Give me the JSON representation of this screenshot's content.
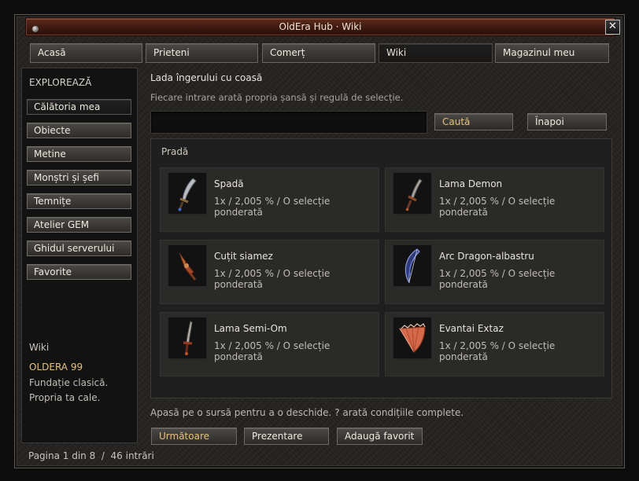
{
  "window": {
    "title": "OldEra Hub · Wiki",
    "close_label": "✕"
  },
  "tabs": [
    {
      "label": "Acasă"
    },
    {
      "label": "Prieteni"
    },
    {
      "label": "Comerț"
    },
    {
      "label": "Wiki",
      "active": true
    },
    {
      "label": "Magazinul meu"
    }
  ],
  "sidebar": {
    "heading": "EXPLOREAZĂ",
    "items": [
      {
        "label": "Călătoria mea",
        "active": true
      },
      {
        "label": "Obiecte"
      },
      {
        "label": "Metine"
      },
      {
        "label": "Monștri și șefi"
      },
      {
        "label": "Temnițe"
      },
      {
        "label": "Atelier GEM"
      },
      {
        "label": "Ghidul serverului"
      },
      {
        "label": "Favorite"
      }
    ],
    "section_label": "Wiki",
    "server_name": "OLDERA 99",
    "tagline_1": "Fundație clasică.",
    "tagline_2": "Propria ta cale."
  },
  "content": {
    "title": "Lada îngerului cu coasă",
    "subtitle": "Fiecare intrare arată propria șansă și regulă de selecție.",
    "search": {
      "value": "",
      "placeholder": ""
    },
    "search_button": "Caută",
    "back_button": "Înapoi"
  },
  "loot": {
    "heading": "Pradă",
    "items": [
      {
        "name": "Spadă",
        "detail": "1x / 2,005 % / O selecție ponderată",
        "icon": "sword-icon"
      },
      {
        "name": "Lama Demon",
        "detail": "1x / 2,005 % / O selecție ponderată",
        "icon": "demon-blade-icon"
      },
      {
        "name": "Cuțit siamez",
        "detail": "1x / 2,005 % / O selecție ponderată",
        "icon": "twin-dagger-icon"
      },
      {
        "name": "Arc Dragon-albastru",
        "detail": "1x / 2,005 % / O selecție ponderată",
        "icon": "bow-icon"
      },
      {
        "name": "Lama Semi-Om",
        "detail": "1x / 2,005 % / O selecție ponderată",
        "icon": "half-man-blade-icon"
      },
      {
        "name": "Evantai Extaz",
        "detail": "1x / 2,005 % / O selecție ponderată",
        "icon": "fan-icon"
      }
    ]
  },
  "footer": {
    "hint": "Apasă pe o sursă pentru a o deschide. ? arată condițiile complete.",
    "next_button": "Următoare",
    "overview_button": "Prezentare",
    "favorite_button": "Adaugă favorit",
    "page_info": "Pagina 1 din 8  /  46 intrări"
  },
  "colors": {
    "accent_gold": "#e7c27b",
    "titlebar_red": "#4a1d12",
    "panel_bg": "#232221"
  }
}
